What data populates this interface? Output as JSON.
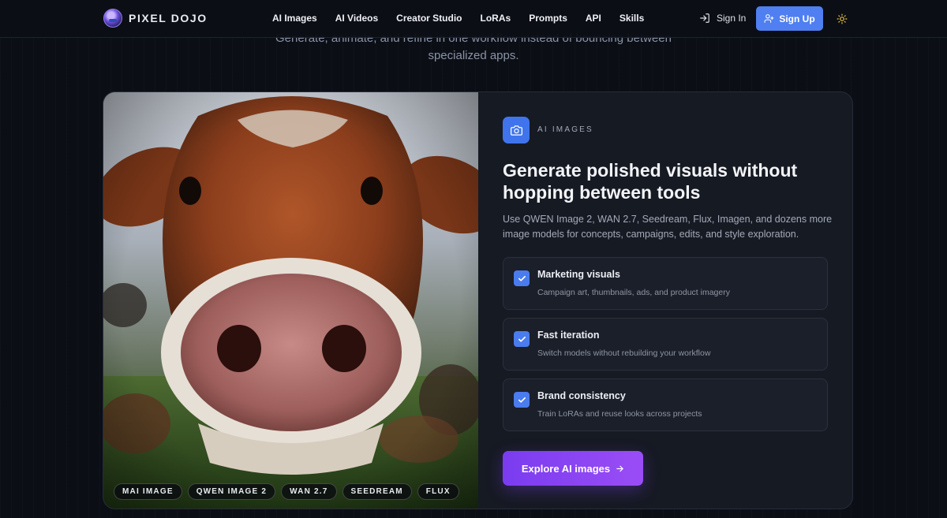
{
  "brand": {
    "name": "PIXEL DOJO"
  },
  "nav": {
    "items": [
      {
        "label": "AI Images"
      },
      {
        "label": "AI Videos"
      },
      {
        "label": "Creator Studio"
      },
      {
        "label": "LoRAs"
      },
      {
        "label": "Prompts"
      },
      {
        "label": "API"
      },
      {
        "label": "Skills"
      }
    ],
    "sign_in": "Sign In",
    "sign_up": "Sign Up"
  },
  "intro": {
    "line1": "Generate, animate, and refine in one workflow instead of bouncing between",
    "line2": "specialized apps."
  },
  "card": {
    "eyebrow": "AI IMAGES",
    "headline": "Generate polished visuals without hopping between tools",
    "description": "Use QWEN Image 2, WAN 2.7, Seedream, Flux, Imagen, and dozens more image models for concepts, campaigns, edits, and style exploration.",
    "features": [
      {
        "title": "Marketing visuals",
        "desc": "Campaign art, thumbnails, ads, and product imagery"
      },
      {
        "title": "Fast iteration",
        "desc": "Switch models without rebuilding your workflow"
      },
      {
        "title": "Brand consistency",
        "desc": "Train LoRAs and reuse looks across projects"
      }
    ],
    "cta": "Explore AI images",
    "model_tags": [
      "MAI IMAGE",
      "QWEN IMAGE 2",
      "WAN 2.7",
      "SEEDREAM",
      "FLUX"
    ]
  },
  "colors": {
    "accent_blue": "#4f7ff0",
    "cta_purple": "#8a45f3",
    "background": "#0b0e15",
    "card": "#161a23"
  },
  "icons": {
    "logo": "pixel-dojo-logo",
    "sign_in": "log-in-icon",
    "sign_up": "user-plus-icon",
    "theme": "sun-icon",
    "badge": "camera-icon",
    "check": "check-icon",
    "cta": "arrow-right-icon"
  }
}
